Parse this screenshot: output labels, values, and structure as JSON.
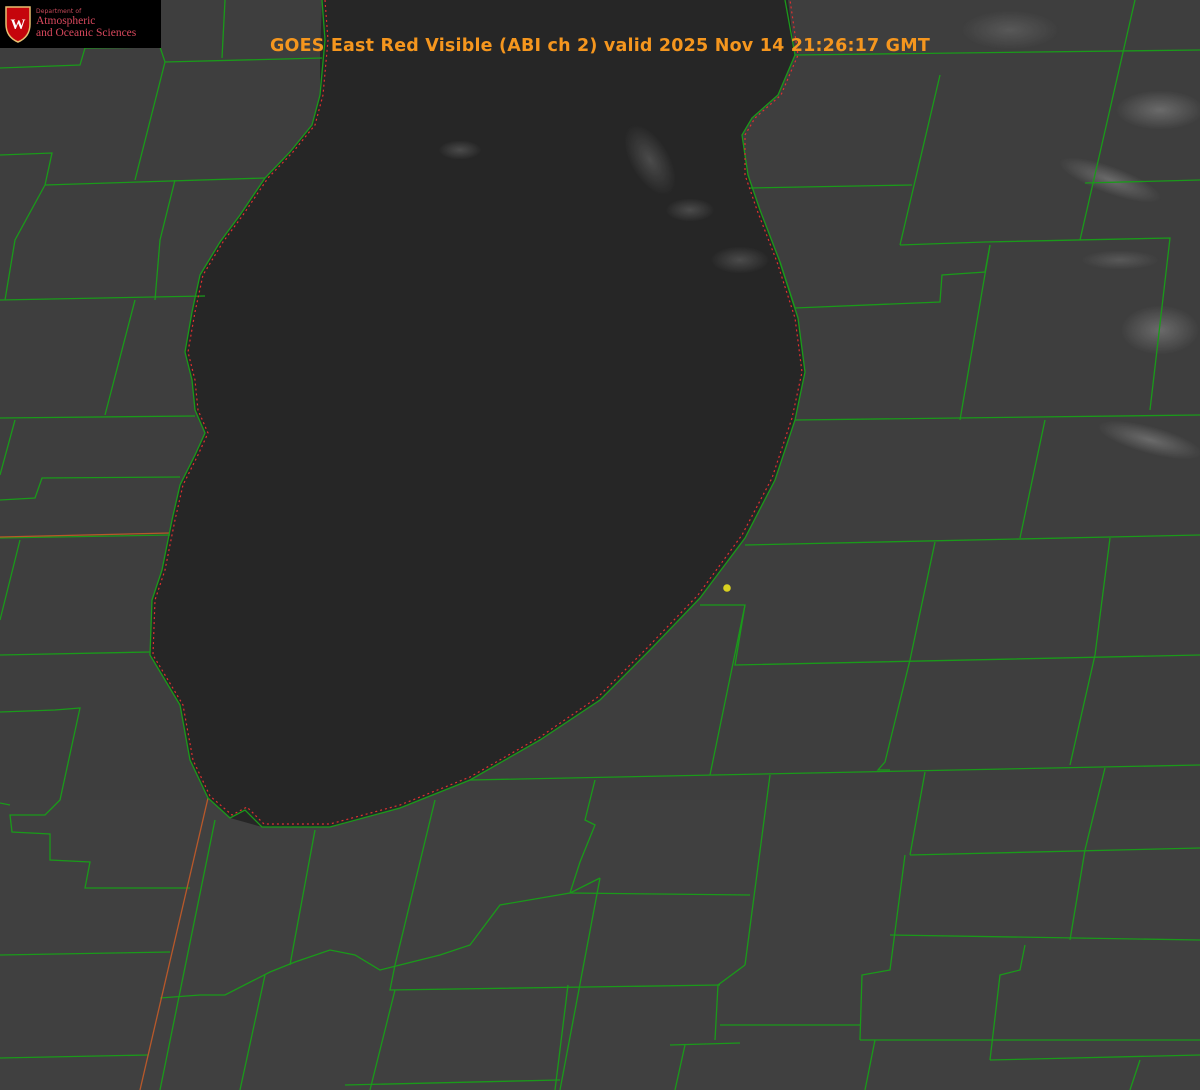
{
  "title": "GOES East Red Visible (ABI ch 2) valid 2025 Nov 14 21:26:17 GMT",
  "logo": {
    "department_label": "Department of",
    "line1": "Atmospheric",
    "line2": "and Oceanic Sciences",
    "emblem": "uw-crest-icon",
    "emblem_letter": "W"
  },
  "colors": {
    "land": "#3f3f3f",
    "lake": "#262626",
    "county_lines": "#1a9a1a",
    "state_border": "#c84a2a",
    "shoreline_dots": "#e03030",
    "marker": "#d8d020",
    "title": "#f5961e",
    "logo_text": "#d8485d"
  },
  "map_layers": [
    "satellite-visible-imagery",
    "county-boundaries",
    "state-boundaries",
    "lake-shoreline",
    "location-marker"
  ]
}
